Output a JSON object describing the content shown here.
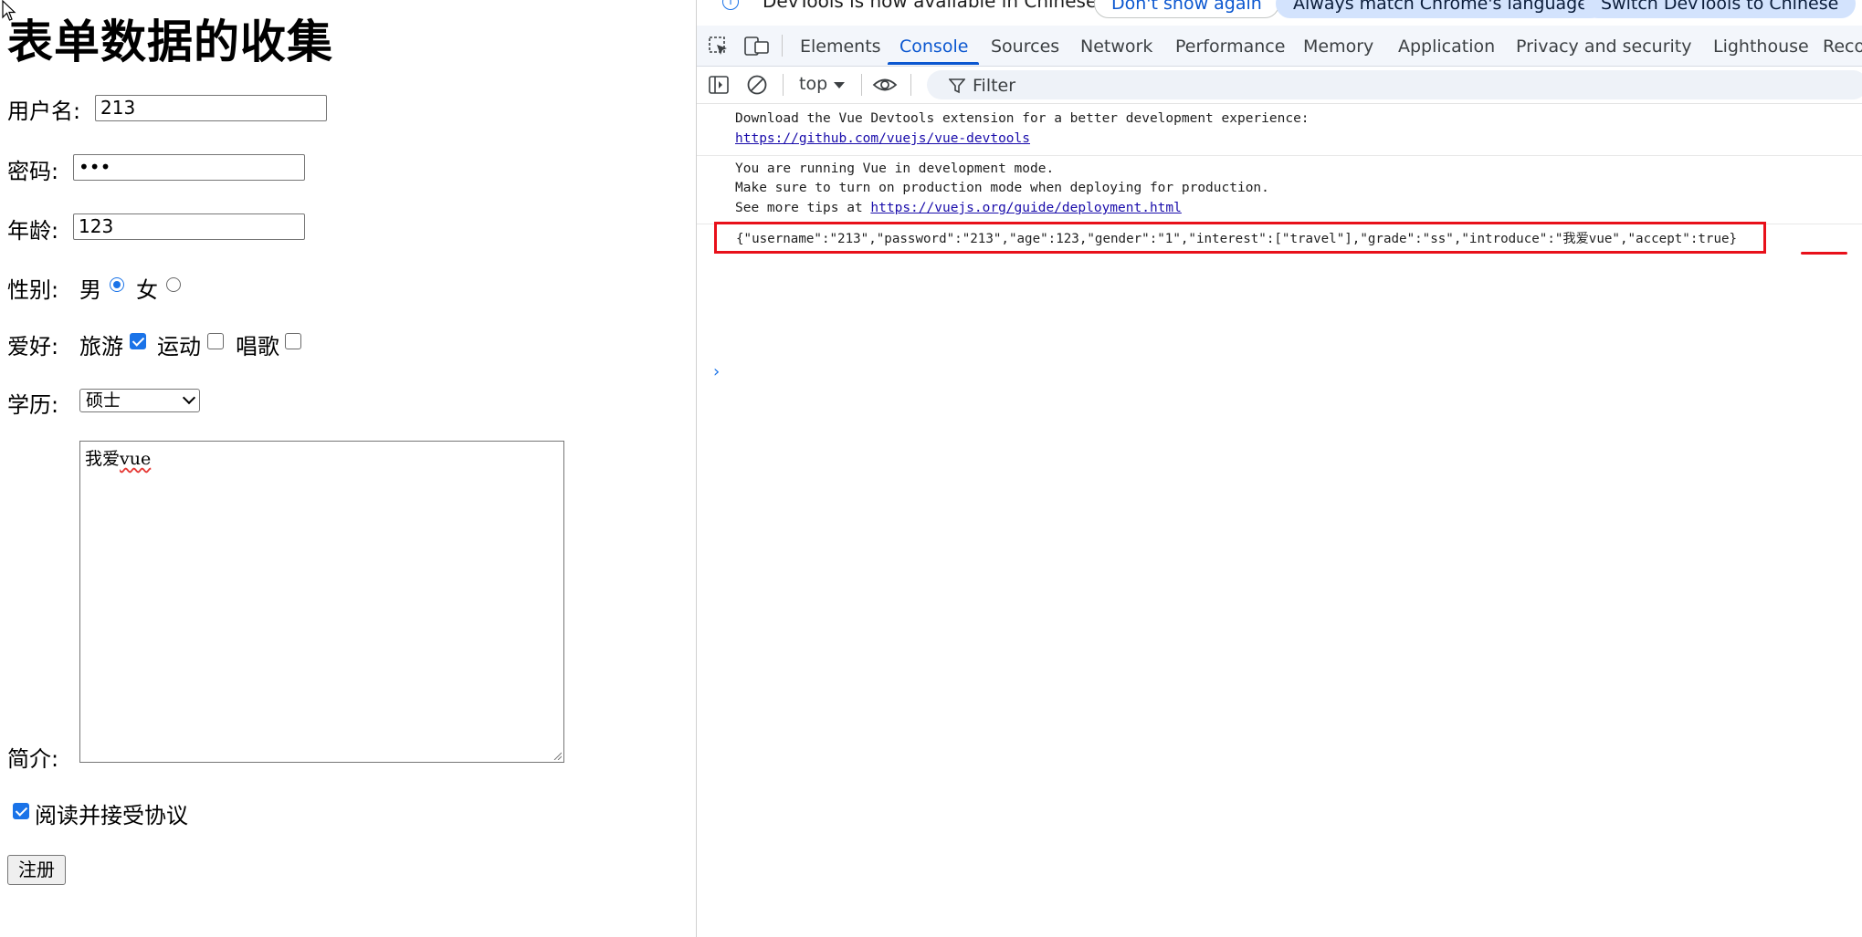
{
  "form": {
    "title": "表单数据的收集",
    "username_label": "用户名:",
    "username_value": "213",
    "password_label": "密码:",
    "password_value": "•••",
    "age_label": "年龄:",
    "age_value": "123",
    "gender_label": "性别:",
    "gender_male": "男",
    "gender_female": "女",
    "gender_selected": "男",
    "hobby_label": "爱好:",
    "hobby_travel": "旅游",
    "hobby_sport": "运动",
    "hobby_sing": "唱歌",
    "hobby_checked": [
      "旅游"
    ],
    "grade_label": "学历:",
    "grade_value": "硕士",
    "intro_label": "简介:",
    "intro_text_prefix": "我爱",
    "intro_text_word": "vue",
    "accept_label": "阅读并接受协议",
    "accept_checked": true,
    "submit_label": "注册"
  },
  "devtools": {
    "info_message": "DevTools is now available in Chinese",
    "btn_dont_show": "Don't show again",
    "btn_match_lang": "Always match Chrome's language",
    "btn_switch": "Switch DevTools to Chinese",
    "tabs": [
      "Elements",
      "Console",
      "Sources",
      "Network",
      "Performance",
      "Memory",
      "Application",
      "Privacy and security",
      "Lighthouse",
      "Reco"
    ],
    "active_tab": "Console",
    "context": "top",
    "filter_placeholder": "Filter",
    "console": {
      "msg1_line1": "Download the Vue Devtools extension for a better development experience:",
      "msg1_link": "https://github.com/vuejs/vue-devtools",
      "msg2_line1": "You are running Vue in development mode.",
      "msg2_line2": "Make sure to turn on production mode when deploying for production.",
      "msg2_line3_prefix": "See more tips at ",
      "msg2_link": "https://vuejs.org/guide/deployment.html",
      "msg3": "{\"username\":\"213\",\"password\":\"213\",\"age\":123,\"gender\":\"1\",\"interest\":[\"travel\"],\"grade\":\"ss\",\"introduce\":\"我爱vue\",\"accept\":true}"
    }
  },
  "colors": {
    "accent": "#1a73e8",
    "highlight_red": "#e8101a",
    "devtools_active": "#0b57d0"
  }
}
